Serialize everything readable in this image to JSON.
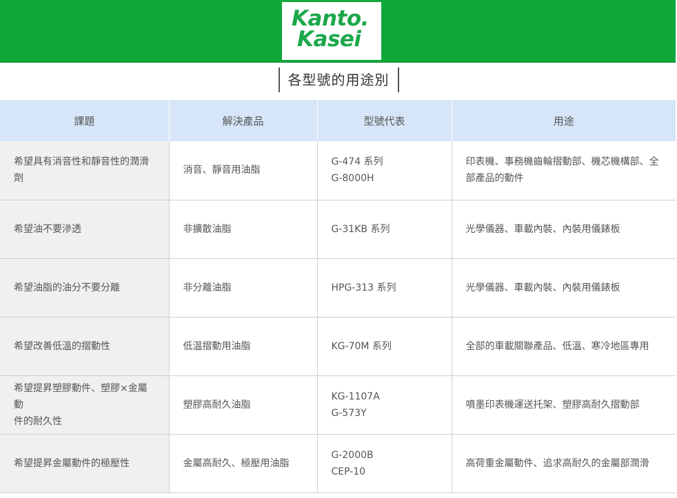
{
  "brand": {
    "logo_line1": "Kanto.",
    "logo_line2": "Kasei",
    "color": "#11a83b"
  },
  "page": {
    "title": "各型號的用途別"
  },
  "table": {
    "columns": [
      "課題",
      "解決產品",
      "型號代表",
      "用途"
    ],
    "rows": [
      {
        "issue": [
          "希望具有消音性和靜音性的潤滑",
          "劑"
        ],
        "solution": "消音、靜音用油脂",
        "models": [
          "G-474 系列",
          "G-8000H"
        ],
        "usage": [
          "印表機、事務機齒輪摺動部、機芯機構部、全",
          "部產品的動件"
        ]
      },
      {
        "issue": [
          "希望油不要滲透"
        ],
        "solution": "非擴散油脂",
        "models": [
          "G-31KB 系列"
        ],
        "usage": [
          "光學儀器、車載內裝、內裝用儀錶板"
        ]
      },
      {
        "issue": [
          "希望油脂的油分不要分離"
        ],
        "solution": "非分離油脂",
        "models": [
          "HPG-313 系列"
        ],
        "usage": [
          "光學儀器、車載內裝、內裝用儀錶板"
        ]
      },
      {
        "issue": [
          "希望改善低溫的摺動性"
        ],
        "solution": "低温摺動用油脂",
        "models": [
          "KG-70M 系列"
        ],
        "usage": [
          "全部的車載關聯產品、低溫、寒冷地區專用"
        ]
      },
      {
        "issue": [
          "希望提昇塑膠動件、塑膠×金屬動",
          "件的耐久性"
        ],
        "solution": "塑膠高耐久油脂",
        "models": [
          "KG-1107A",
          "G-573Y"
        ],
        "usage": [
          "噴墨印表機運送托架、塑膠高耐久摺動部"
        ]
      },
      {
        "issue": [
          "希望提昇金屬動件的極壓性"
        ],
        "solution": "金屬高耐久、極壓用油脂",
        "models": [
          "G-2000B",
          "CEP-10"
        ],
        "usage": [
          "高荷重金屬動件、追求高耐久的金屬部潤滑"
        ]
      }
    ]
  }
}
